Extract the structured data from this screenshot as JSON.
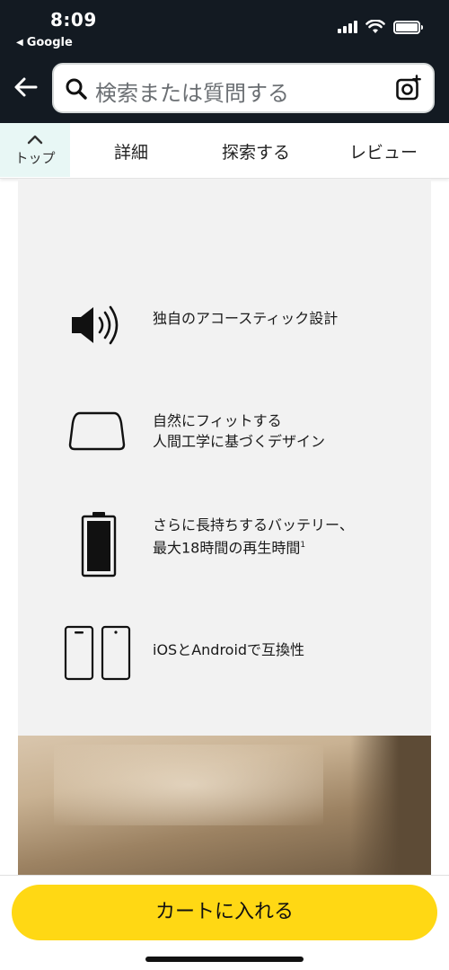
{
  "status_bar": {
    "time": "8:09",
    "back_app": "Google",
    "back_app_icon": "back-triangle-icon"
  },
  "header": {
    "search_placeholder": "検索または質問する"
  },
  "tabs": {
    "top_label": "トップ",
    "items": [
      "詳細",
      "探索する",
      "レビュー"
    ]
  },
  "features": [
    {
      "icon": "speaker-icon",
      "lines": [
        "独自のアコースティック設計"
      ]
    },
    {
      "icon": "earbud-shape-icon",
      "lines": [
        "自然にフィットする",
        "人間工学に基づくデザイン"
      ]
    },
    {
      "icon": "battery-icon",
      "lines": [
        "さらに長持ちするバッテリー、",
        "最大18時間の再生時間"
      ],
      "footnote": "1"
    },
    {
      "icon": "phones-icon",
      "lines": [
        "iOSとAndroidで互換性"
      ]
    }
  ],
  "cart_button": "カートに入れる",
  "colors": {
    "header_bg": "#131a22",
    "cart_button": "#ffd814",
    "top_tab_bg": "#e8f7f5",
    "panel_bg": "#f2f2f2"
  }
}
